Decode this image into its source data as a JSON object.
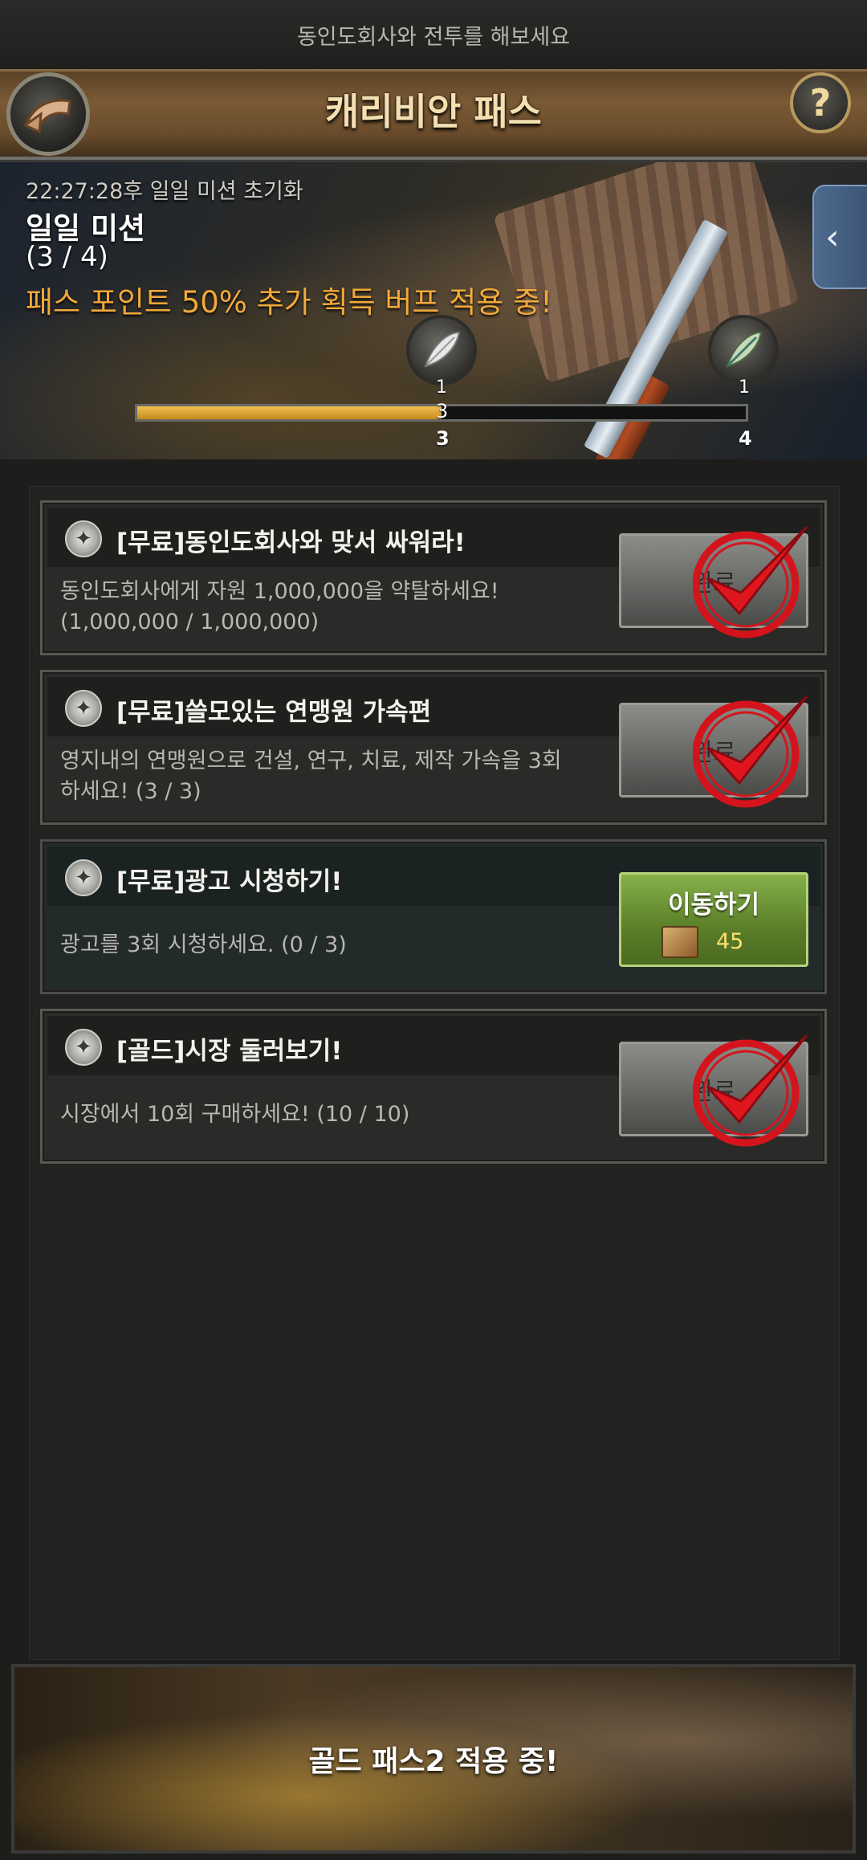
{
  "topbar": {
    "text": "동인도회사와 전투를 해보세요"
  },
  "header": {
    "title": "캐리비안 패스",
    "help_label": "?"
  },
  "banner": {
    "reset_text": "22:27:28후 일일 미션 초기화",
    "mission_title": "일일 미션",
    "mission_count": "(3 / 4)",
    "buff_text": "패스 포인트 50% 추가 획득 버프 적용 중!",
    "side_tab_icon": "chevron-left-icon",
    "rewards": [
      {
        "icon": "silver-feather-icon",
        "count": "1",
        "tick": "3"
      },
      {
        "icon": "green-feather-icon",
        "count": "1",
        "tick": "4"
      }
    ],
    "progress": {
      "current": "3",
      "fraction": 0.5
    }
  },
  "missions": [
    {
      "title": "[무료]동인도회사와 맞서 싸워라!",
      "desc1": "동인도회사에게 자원 1,000,000을 약탈하세요!",
      "desc2": "(1,000,000 / 1,000,000)",
      "button": "완료",
      "completed": true
    },
    {
      "title": "[무료]쓸모있는 연맹원 가속편",
      "desc1": "영지내의 연맹원으로 건설, 연구, 치료, 제작 가속을 3회",
      "desc2": "하세요! (3 / 3)",
      "button": "완료",
      "completed": true
    },
    {
      "title": "[무료]광고 시청하기!",
      "desc1": "광고를 3회 시청하세요. (0 / 3)",
      "button": "이동하기",
      "cost": "45",
      "completed": false
    },
    {
      "title": "[골드]시장 둘러보기!",
      "desc1": "시장에서 10회 구매하세요! (10 / 10)",
      "button": "완료",
      "completed": true
    }
  ],
  "footer": {
    "text": "골드 패스2 적용 중!"
  },
  "colors": {
    "buff": "#f2a93a",
    "check": "#d4141c",
    "go_button": "#6a9434"
  }
}
